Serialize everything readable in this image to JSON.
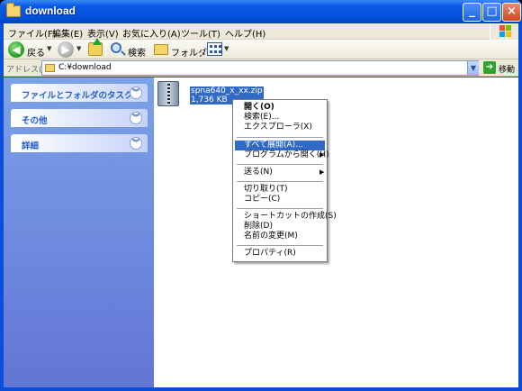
{
  "window": {
    "title": "download"
  },
  "menubar": {
    "items": [
      "ファイル(F)",
      "編集(E)",
      "表示(V)",
      "お気に入り(A)",
      "ツール(T)",
      "ヘルプ(H)"
    ]
  },
  "toolbar": {
    "back_label": "戻る",
    "search_label": "検索",
    "folders_label": "フォルダ"
  },
  "addressbar": {
    "label": "アドレス(D)",
    "value": "C:¥download",
    "go_label": "移動"
  },
  "taskpane": {
    "groups": [
      "ファイルとフォルダのタスク",
      "その他",
      "詳細"
    ]
  },
  "file": {
    "name": "spna640_x_xx.zip",
    "size": "1,736 KB"
  },
  "context_menu": {
    "items": [
      {
        "label": "開く(O)"
      },
      {
        "label": "検索(E)..."
      },
      {
        "label": "エクスプローラ(X)"
      },
      {
        "label": "すべて展開(A)..."
      },
      {
        "label": "プログラムから開く(H)"
      },
      {
        "label": "送る(N)"
      },
      {
        "label": "切り取り(T)"
      },
      {
        "label": "コピー(C)"
      },
      {
        "label": "ショートカットの作成(S)"
      },
      {
        "label": "削除(D)"
      },
      {
        "label": "名前の変更(M)"
      },
      {
        "label": "プロパティ(R)"
      }
    ],
    "highlighted_index": 3
  },
  "colors": {
    "titlebar": "#0352dc",
    "selection": "#316ac5",
    "task_pane": "#6f8ddf",
    "task_title": "#215dc6"
  }
}
